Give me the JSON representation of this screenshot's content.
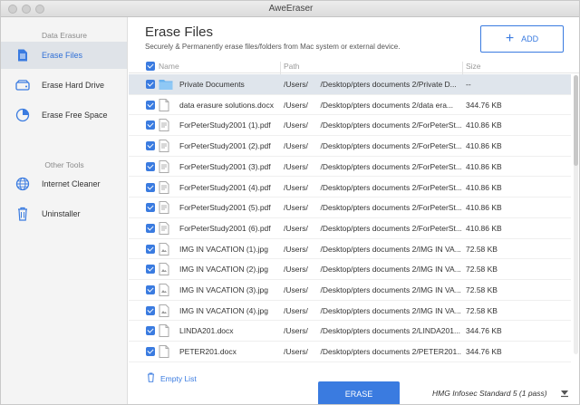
{
  "window": {
    "title": "AweEraser"
  },
  "sidebar": {
    "section1": "Data Erasure",
    "items1": [
      {
        "label": "Erase Files",
        "icon": "file-icon"
      },
      {
        "label": "Erase Hard Drive",
        "icon": "hard-drive-icon"
      },
      {
        "label": "Erase Free Space",
        "icon": "pie-chart-icon"
      }
    ],
    "section2": "Other Tools",
    "items2": [
      {
        "label": "Internet Cleaner",
        "icon": "globe-icon"
      },
      {
        "label": "Uninstaller",
        "icon": "trash-icon"
      }
    ]
  },
  "main": {
    "title": "Erase Files",
    "subtitle": "Securely & Permanently erase files/folders from Mac system or external device.",
    "add_label": "ADD"
  },
  "table": {
    "headers": {
      "name": "Name",
      "path": "Path",
      "size": "Size"
    },
    "rows": [
      {
        "name": "Private Documents",
        "path": "/Users/        /Desktop/pters documents 2/Private D...",
        "size": "--",
        "type": "folder",
        "selected": true
      },
      {
        "name": "data erasure solutions.docx",
        "path": "/Users/        /Desktop/pters documents 2/data era...",
        "size": "344.76 KB",
        "type": "doc"
      },
      {
        "name": "ForPeterStudy2001 (1).pdf",
        "path": "/Users/        /Desktop/pters documents 2/ForPeterSt...",
        "size": "410.86 KB",
        "type": "pdf"
      },
      {
        "name": "ForPeterStudy2001 (2).pdf",
        "path": "/Users/        /Desktop/pters documents 2/ForPeterSt...",
        "size": "410.86 KB",
        "type": "pdf"
      },
      {
        "name": "ForPeterStudy2001 (3).pdf",
        "path": "/Users/        /Desktop/pters documents 2/ForPeterSt...",
        "size": "410.86 KB",
        "type": "pdf"
      },
      {
        "name": "ForPeterStudy2001 (4).pdf",
        "path": "/Users/        /Desktop/pters documents 2/ForPeterSt...",
        "size": "410.86 KB",
        "type": "pdf"
      },
      {
        "name": "ForPeterStudy2001 (5).pdf",
        "path": "/Users/        /Desktop/pters documents 2/ForPeterSt...",
        "size": "410.86 KB",
        "type": "pdf"
      },
      {
        "name": "ForPeterStudy2001 (6).pdf",
        "path": "/Users/        /Desktop/pters documents 2/ForPeterSt...",
        "size": "410.86 KB",
        "type": "pdf"
      },
      {
        "name": "IMG IN VACATION (1).jpg",
        "path": "/Users/        /Desktop/pters documents 2/IMG IN VA...",
        "size": "72.58 KB",
        "type": "img"
      },
      {
        "name": "IMG IN VACATION (2).jpg",
        "path": "/Users/        /Desktop/pters documents 2/IMG IN VA...",
        "size": "72.58 KB",
        "type": "img"
      },
      {
        "name": "IMG IN VACATION (3).jpg",
        "path": "/Users/        /Desktop/pters documents 2/IMG IN VA...",
        "size": "72.58 KB",
        "type": "img"
      },
      {
        "name": "IMG IN VACATION (4).jpg",
        "path": "/Users/        /Desktop/pters documents 2/IMG IN VA...",
        "size": "72.58 KB",
        "type": "img"
      },
      {
        "name": "LINDA201.docx",
        "path": "/Users/        /Desktop/pters documents 2/LINDA201...",
        "size": "344.76 KB",
        "type": "doc"
      },
      {
        "name": "PETER201.docx",
        "path": "/Users/        /Desktop/pters documents 2/PETER201...",
        "size": "344.76 KB",
        "type": "doc"
      }
    ]
  },
  "footer": {
    "empty_label": "Empty List",
    "erase_label": "ERASE",
    "method": "HMG Infosec Standard 5 (1 pass)"
  },
  "colors": {
    "accent": "#3a7be0",
    "selected_row": "#dfe5ec",
    "sidebar_bg": "#f4f4f4"
  }
}
